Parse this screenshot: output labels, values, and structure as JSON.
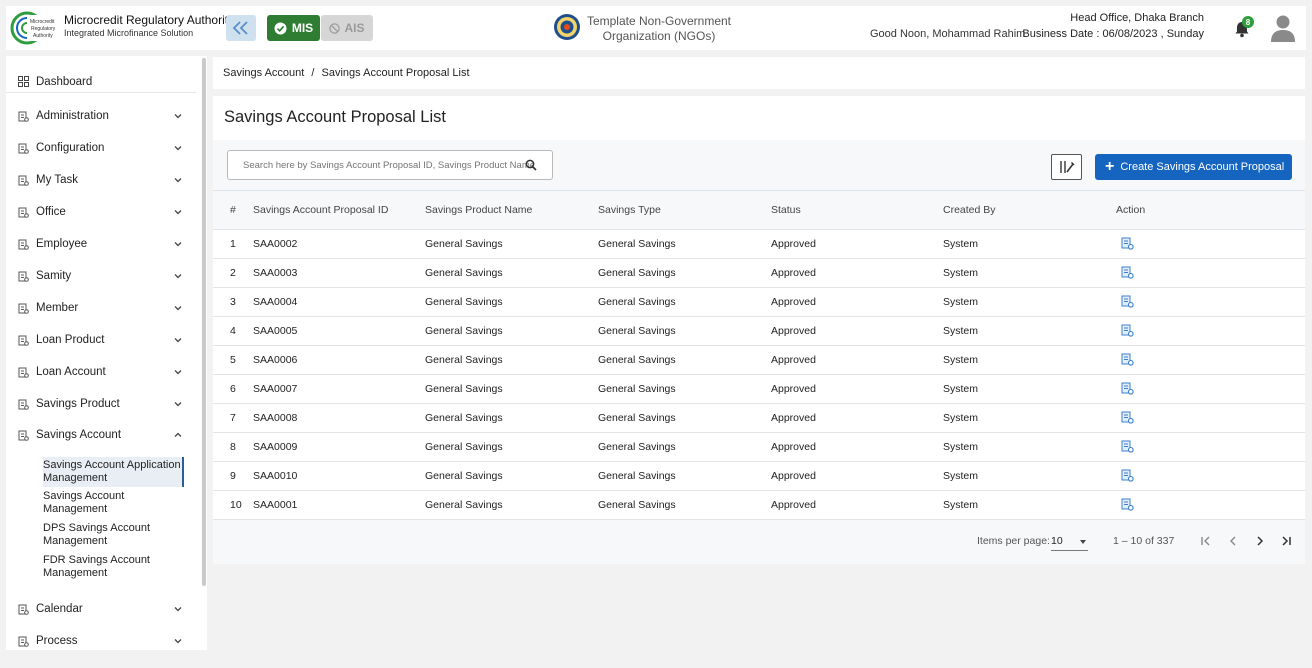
{
  "header": {
    "org_name": "Microcredit Regulatory Authority",
    "org_sub": "Integrated Microfinance Solution",
    "logo_text": "Microcredit Regulatory Authority",
    "mis_label": "MIS",
    "ais_label": "AIS",
    "ngo_line1": "Template Non-Government",
    "ngo_line2": "Organization (NGOs)",
    "greeting": "Good Noon, Mohammad Rahim",
    "branch": "Head Office, Dhaka Branch",
    "business_date": "Business Date : 06/08/2023 , Sunday",
    "notification_count": "8",
    "colors": {
      "mis": "#2e7d32",
      "primary": "#1565c0",
      "badge": "#2e9e3c"
    }
  },
  "sidebar": {
    "dashboard": "Dashboard",
    "items": [
      {
        "label": "Administration",
        "icon": "admin-icon"
      },
      {
        "label": "Configuration",
        "icon": "sliders-icon"
      },
      {
        "label": "My Task",
        "icon": "task-icon"
      },
      {
        "label": "Office",
        "icon": "office-icon"
      },
      {
        "label": "Employee",
        "icon": "employee-icon"
      },
      {
        "label": "Samity",
        "icon": "samity-icon"
      },
      {
        "label": "Member",
        "icon": "member-icon"
      },
      {
        "label": "Loan Product",
        "icon": "loan-product-icon"
      },
      {
        "label": "Loan Account",
        "icon": "loan-account-icon"
      },
      {
        "label": "Savings Product",
        "icon": "savings-product-icon"
      },
      {
        "label": "Savings Account",
        "icon": "savings-account-icon"
      }
    ],
    "sub_items": [
      "Savings Account Application Management",
      "Savings Account Management",
      "DPS Savings Account Management",
      "FDR Savings Account Management"
    ],
    "bottom_items": [
      {
        "label": "Calendar",
        "icon": "calendar-icon"
      },
      {
        "label": "Process",
        "icon": "process-icon"
      }
    ]
  },
  "breadcrumb": {
    "parent": "Savings Account",
    "separator": "/",
    "current": "Savings Account Proposal List"
  },
  "page": {
    "title": "Savings Account Proposal List",
    "search_placeholder": "Search here by Savings Account Proposal ID, Savings Product Name etc.",
    "create_label": "Create Savings Account Proposal"
  },
  "table": {
    "headers": [
      "#",
      "Savings Account Proposal ID",
      "Savings Product Name",
      "Savings Type",
      "Status",
      "Created By",
      "Action"
    ],
    "rows": [
      {
        "idx": "1",
        "id": "SAA0002",
        "product": "General Savings",
        "type": "General Savings",
        "status": "Approved",
        "created_by": "System"
      },
      {
        "idx": "2",
        "id": "SAA0003",
        "product": "General Savings",
        "type": "General Savings",
        "status": "Approved",
        "created_by": "System"
      },
      {
        "idx": "3",
        "id": "SAA0004",
        "product": "General Savings",
        "type": "General Savings",
        "status": "Approved",
        "created_by": "System"
      },
      {
        "idx": "4",
        "id": "SAA0005",
        "product": "General Savings",
        "type": "General Savings",
        "status": "Approved",
        "created_by": "System"
      },
      {
        "idx": "5",
        "id": "SAA0006",
        "product": "General Savings",
        "type": "General Savings",
        "status": "Approved",
        "created_by": "System"
      },
      {
        "idx": "6",
        "id": "SAA0007",
        "product": "General Savings",
        "type": "General Savings",
        "status": "Approved",
        "created_by": "System"
      },
      {
        "idx": "7",
        "id": "SAA0008",
        "product": "General Savings",
        "type": "General Savings",
        "status": "Approved",
        "created_by": "System"
      },
      {
        "idx": "8",
        "id": "SAA0009",
        "product": "General Savings",
        "type": "General Savings",
        "status": "Approved",
        "created_by": "System"
      },
      {
        "idx": "9",
        "id": "SAA0010",
        "product": "General Savings",
        "type": "General Savings",
        "status": "Approved",
        "created_by": "System"
      },
      {
        "idx": "10",
        "id": "SAA0001",
        "product": "General Savings",
        "type": "General Savings",
        "status": "Approved",
        "created_by": "System"
      }
    ]
  },
  "paginator": {
    "items_per_page_label": "Items per page:",
    "items_per_page": "10",
    "range": "1 – 10 of 337"
  }
}
